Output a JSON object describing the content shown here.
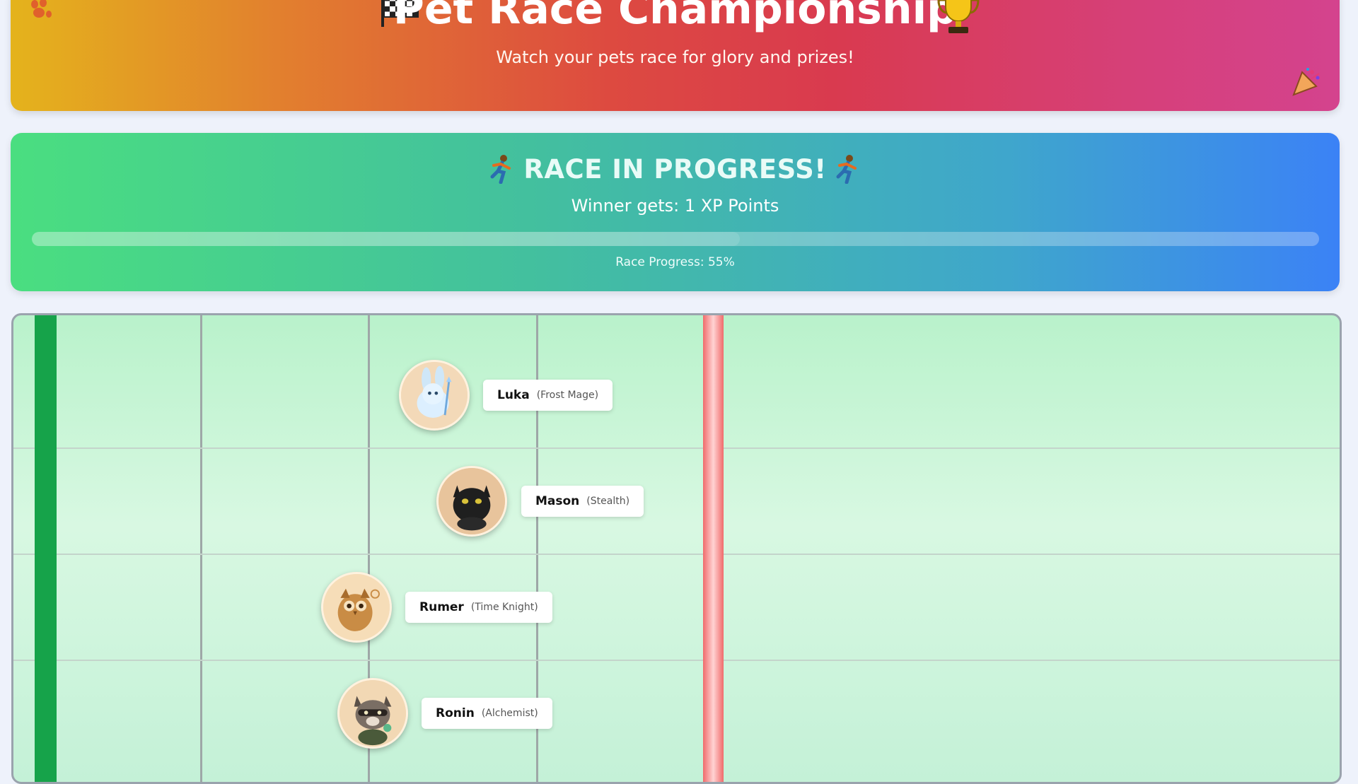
{
  "header": {
    "title": "Pet Race Championship",
    "subtitle": "Watch your pets race for glory and prizes!",
    "icons": [
      "paw-icon",
      "checkered-flag-icon",
      "trophy-icon",
      "party-popper-icon"
    ]
  },
  "status": {
    "title": "RACE IN PROGRESS!",
    "prize": "Winner gets: 1 XP Points",
    "progress_label": "Race Progress: 55%",
    "progress_percent": 55,
    "icons": [
      "runner-icon",
      "runner-icon"
    ]
  },
  "racers": [
    {
      "name": "Luka",
      "class": "(Frost Mage)",
      "avatar": "frost-bunny-icon"
    },
    {
      "name": "Mason",
      "class": "(Stealth)",
      "avatar": "black-cat-icon"
    },
    {
      "name": "Rumer",
      "class": "(Time Knight)",
      "avatar": "owl-icon"
    },
    {
      "name": "Ronin",
      "class": "(Alchemist)",
      "avatar": "raccoon-icon"
    }
  ],
  "colors": {
    "start_line": "#16a34a",
    "finish_line": "#f06b6b",
    "header_gradient_start": "#e4b31c",
    "header_gradient_end": "#d4438e",
    "status_gradient_start": "#4ade80",
    "status_gradient_end": "#3b82f6"
  }
}
